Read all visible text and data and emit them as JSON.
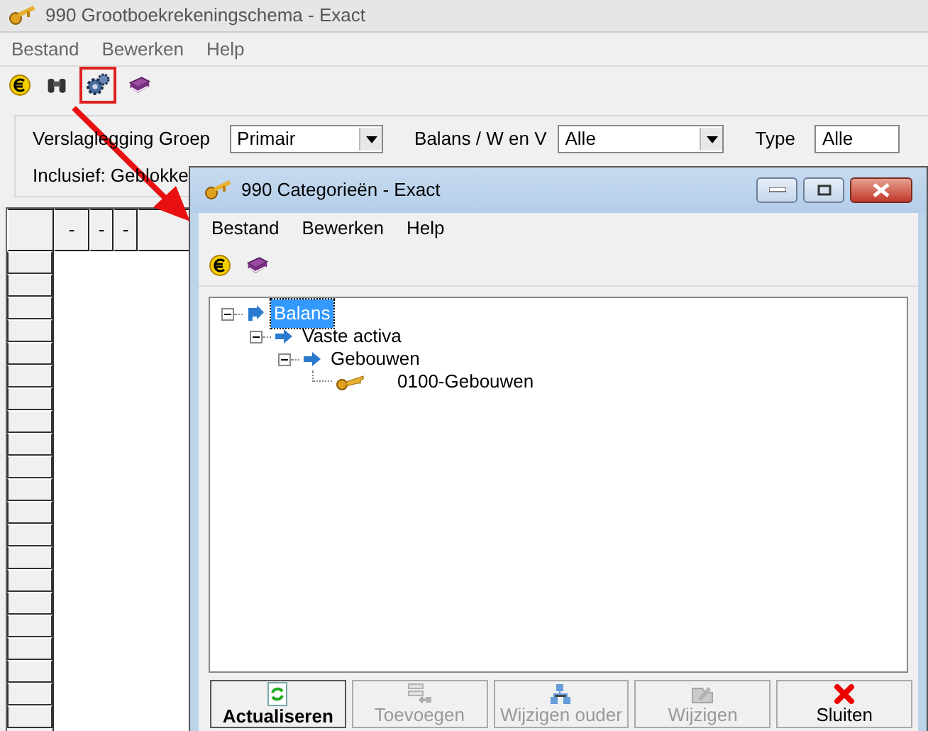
{
  "main_window": {
    "title": "990 Grootboekrekeningschema - Exact",
    "menu": [
      "Bestand",
      "Bewerken",
      "Help"
    ],
    "toolbar": [
      {
        "kind": "euro",
        "highlighted": false
      },
      {
        "kind": "binoculars",
        "highlighted": false
      },
      {
        "kind": "gear",
        "highlighted": true
      },
      {
        "kind": "book",
        "highlighted": false
      }
    ],
    "filters": [
      {
        "label": "Verslaglegging Groep",
        "value": "Primair"
      },
      {
        "label": "Balans / W en V",
        "value": "Alle"
      },
      {
        "label": "Type",
        "value": "Alle"
      }
    ],
    "inclusief": "Inclusief: Geblokke",
    "grid": {
      "columns": [
        "-",
        "-",
        "-"
      ]
    }
  },
  "callout_arrow": true,
  "dialog": {
    "title": "990 Categorieën - Exact",
    "menu": [
      "Bestand",
      "Bewerken",
      "Help"
    ],
    "toolbar": [
      {
        "kind": "euro"
      },
      {
        "kind": "book"
      }
    ],
    "tree": [
      {
        "label": "Balans",
        "kind": "root",
        "selected": true,
        "expanded": true,
        "children": [
          {
            "label": "Vaste activa",
            "kind": "category",
            "selected": false,
            "expanded": true,
            "children": [
              {
                "label": "Gebouwen",
                "kind": "category",
                "selected": false,
                "expanded": true,
                "children": [
                  {
                    "label": "0100-Gebouwen",
                    "kind": "account",
                    "selected": false
                  }
                ]
              }
            ]
          }
        ]
      }
    ],
    "buttons": [
      {
        "label": "Actualiseren",
        "kind": "refresh",
        "disabled": false,
        "default": true
      },
      {
        "label": "Toevoegen",
        "kind": "add",
        "disabled": true,
        "default": false
      },
      {
        "label": "Wijzigen ouder",
        "kind": "hierarchy",
        "disabled": true,
        "default": false
      },
      {
        "label": "Wijzigen",
        "kind": "edit",
        "disabled": true,
        "default": false
      },
      {
        "label": "Sluiten",
        "kind": "close",
        "disabled": false,
        "default": false
      }
    ]
  }
}
